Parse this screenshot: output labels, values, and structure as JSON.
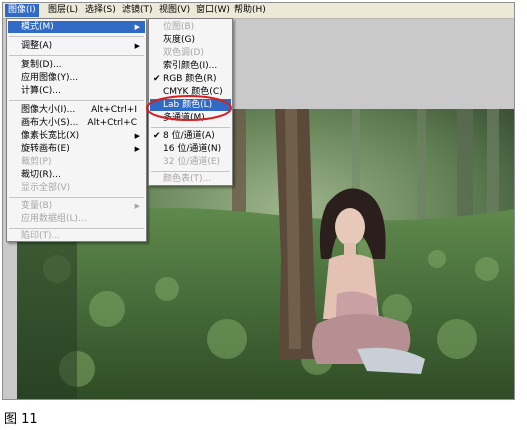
{
  "menubar": [
    {
      "label": "图像(I)",
      "active": true
    },
    {
      "label": "图层(L)"
    },
    {
      "label": "选择(S)"
    },
    {
      "label": "滤镜(T)"
    },
    {
      "label": "视图(V)"
    },
    {
      "label": "窗口(W)"
    },
    {
      "label": "帮助(H)"
    }
  ],
  "image_menu": {
    "items": [
      {
        "label": "模式(M)",
        "submenu": true,
        "highlight": true
      },
      {
        "label": "调整(A)",
        "submenu": true
      },
      {
        "label": "复制(D)..."
      },
      {
        "label": "应用图像(Y)..."
      },
      {
        "label": "计算(C)..."
      },
      {
        "label": "图像大小(I)...",
        "shortcut": "Alt+Ctrl+I"
      },
      {
        "label": "画布大小(S)...",
        "shortcut": "Alt+Ctrl+C"
      },
      {
        "label": "像素长宽比(X)",
        "submenu": true
      },
      {
        "label": "旋转画布(E)",
        "submenu": true
      },
      {
        "label": "裁剪(P)",
        "disabled": true
      },
      {
        "label": "裁切(R)..."
      },
      {
        "label": "显示全部(V)",
        "disabled": true
      },
      {
        "label": "变量(B)",
        "submenu": true,
        "disabled": true
      },
      {
        "label": "应用数据组(L)...",
        "disabled": true
      },
      {
        "label": "陷印(T)...",
        "disabled": true
      }
    ]
  },
  "mode_submenu": {
    "items": [
      {
        "label": "位图(B)",
        "disabled": true
      },
      {
        "label": "灰度(G)"
      },
      {
        "label": "双色调(D)",
        "disabled": true
      },
      {
        "label": "索引颜色(I)..."
      },
      {
        "label": "RGB 颜色(R)",
        "checked": true
      },
      {
        "label": "CMYK 颜色(C)"
      },
      {
        "label": "Lab 颜色(L)",
        "highlight": true
      },
      {
        "label": "多通道(M)"
      },
      {
        "label": "8 位/通道(A)",
        "checked": true
      },
      {
        "label": "16 位/通道(N)"
      },
      {
        "label": "32 位/通道(E)",
        "disabled": true
      },
      {
        "label": "颜色表(T)...",
        "disabled": true
      }
    ]
  },
  "icons": {
    "check": "✔",
    "submenu_arrow": "▶"
  },
  "colors": {
    "highlight": "#316ac5",
    "annotation_circle": "#d42020",
    "menu_bg": "#f5f5f5"
  },
  "caption": "图 11"
}
